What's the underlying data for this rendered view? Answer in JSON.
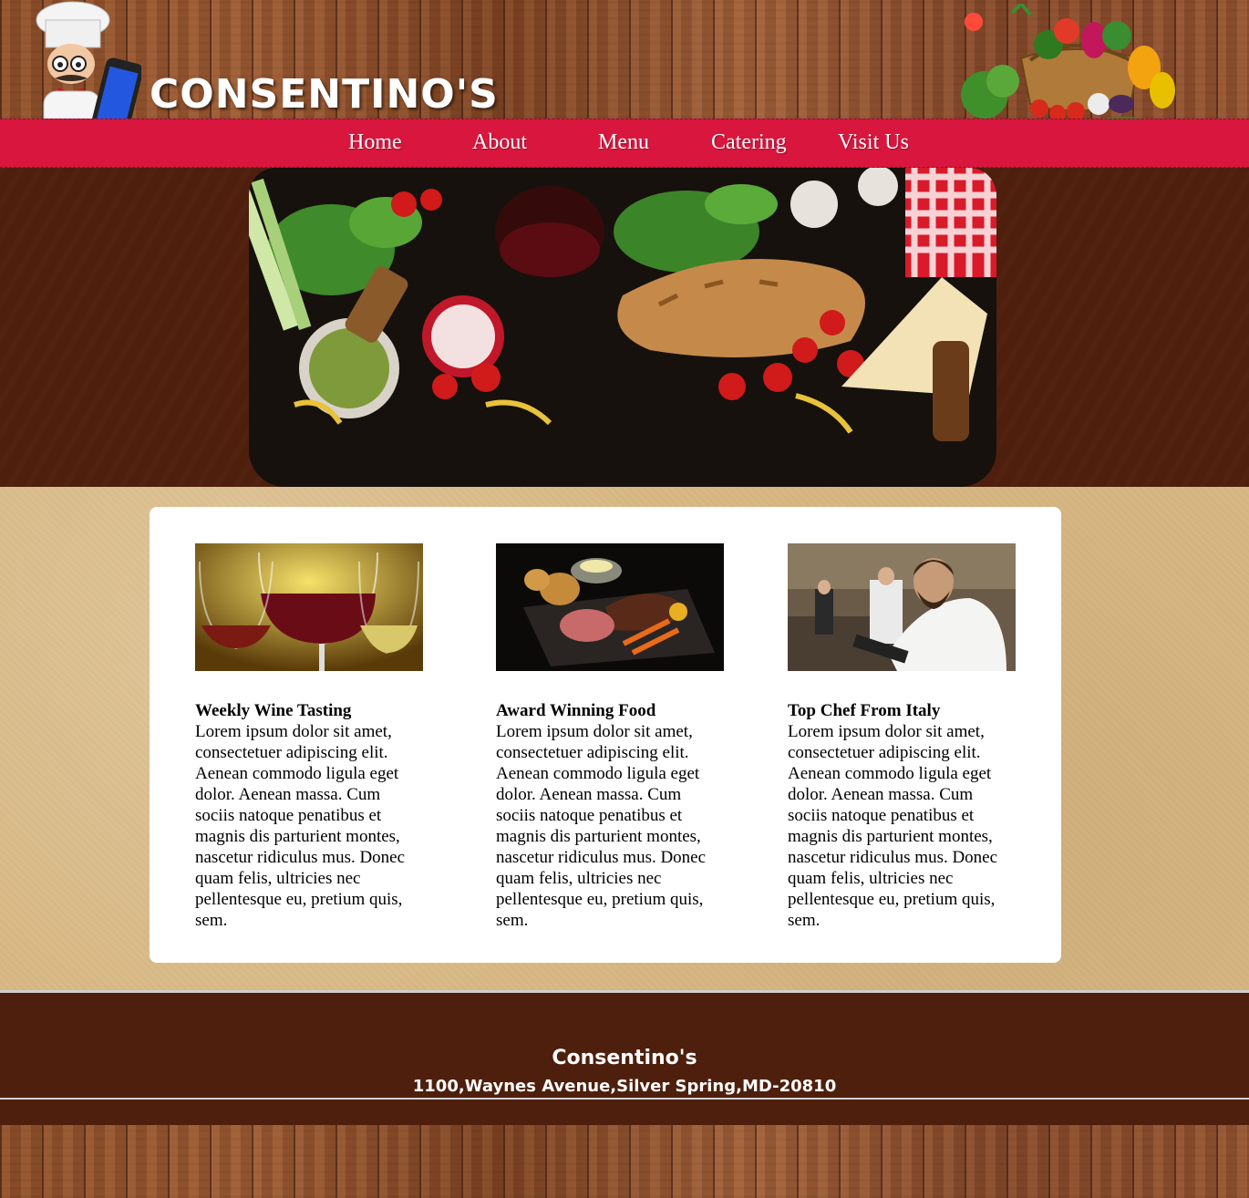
{
  "brand": {
    "title": "CONSENTINO'S"
  },
  "nav": {
    "items": [
      {
        "label": "Home"
      },
      {
        "label": "About"
      },
      {
        "label": "Menu"
      },
      {
        "label": "Catering"
      },
      {
        "label": "Visit Us"
      }
    ]
  },
  "features": [
    {
      "title": "Weekly Wine Tasting",
      "text": "Lorem ipsum dolor sit amet, consectetuer adipiscing elit. Aenean commodo ligula eget dolor. Aenean massa. Cum sociis natoque penatibus et magnis dis parturient montes, nascetur ridiculus mus. Donec quam felis, ultricies nec pellentesque eu, pretium quis, sem."
    },
    {
      "title": "Award Winning Food",
      "text": "Lorem ipsum dolor sit amet, consectetuer adipiscing elit. Aenean commodo ligula eget dolor. Aenean massa. Cum sociis natoque penatibus et magnis dis parturient montes, nascetur ridiculus mus. Donec quam felis, ultricies nec pellentesque eu, pretium quis, sem."
    },
    {
      "title": "Top Chef From Italy",
      "text": "Lorem ipsum dolor sit amet, consectetuer adipiscing elit. Aenean commodo ligula eget dolor. Aenean massa. Cum sociis natoque penatibus et magnis dis parturient montes, nascetur ridiculus mus. Donec quam felis, ultricies nec pellentesque eu, pretium quis, sem."
    }
  ],
  "footer": {
    "name": "Consentino's",
    "address": "1100,Waynes Avenue,Silver Spring,MD-20810"
  },
  "colors": {
    "nav_red": "#d9163e",
    "brown_band": "#4e1f0c",
    "paper": "#d8b985"
  }
}
